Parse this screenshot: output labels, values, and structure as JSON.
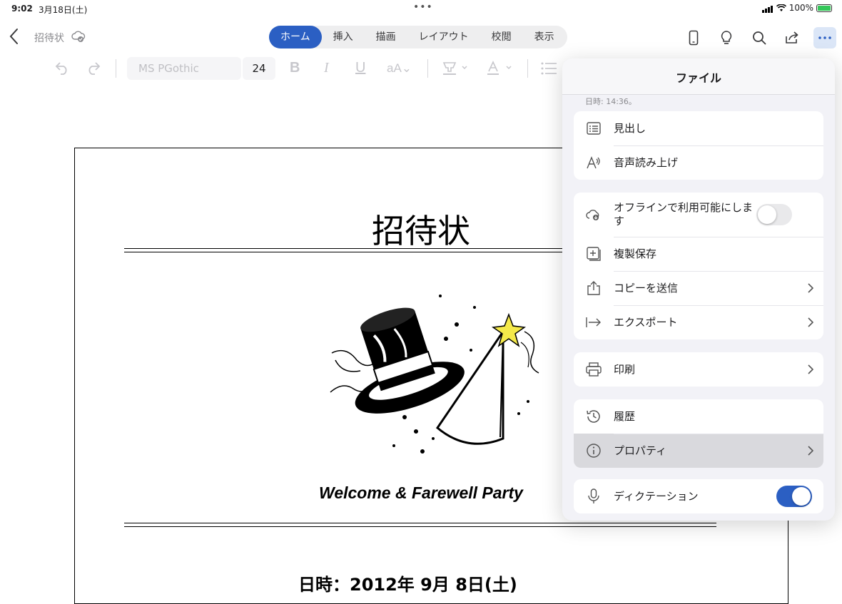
{
  "status": {
    "time": "9:02",
    "date": "3月18日(土)",
    "battery": "100%",
    "battery_level": 1.0
  },
  "topbar": {
    "doc_title": "招待状",
    "tabs": [
      {
        "label": "ホーム",
        "active": true
      },
      {
        "label": "挿入",
        "active": false
      },
      {
        "label": "描画",
        "active": false
      },
      {
        "label": "レイアウト",
        "active": false
      },
      {
        "label": "校閲",
        "active": false
      },
      {
        "label": "表示",
        "active": false
      }
    ],
    "accent": "#2b5fc3"
  },
  "format": {
    "font_name": "MS PGothic",
    "font_size": "24"
  },
  "document": {
    "heading": "招待状",
    "party": "Welcome & Farewell Party",
    "date_line": "日時：2012年 9月 8日(土)"
  },
  "panel": {
    "title": "ファイル",
    "subtext": "日時: 14:36。",
    "items": {
      "headings": "見出し",
      "read_aloud": "音声読み上げ",
      "offline": "オフラインで利用可能にします",
      "offline_on": false,
      "save_copy": "複製保存",
      "send_copy": "コピーを送信",
      "export": "エクスポート",
      "print": "印刷",
      "history": "履歴",
      "properties": "プロパティ",
      "dictation": "ディクテーション",
      "dictation_on": true
    }
  }
}
